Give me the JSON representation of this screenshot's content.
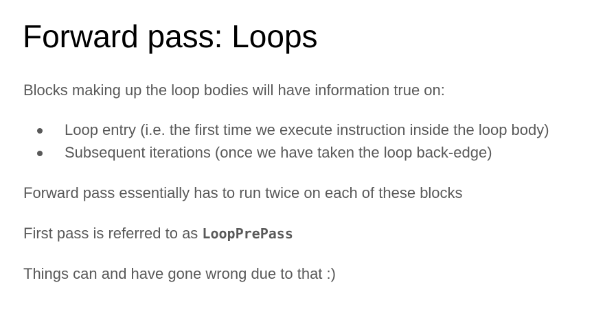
{
  "slide": {
    "title": "Forward pass: Loops",
    "intro": "Blocks making up the loop bodies will have information true on:",
    "bullets": [
      "Loop entry (i.e. the first time we execute instruction inside the loop body)",
      "Subsequent iterations (once we have taken the loop back-edge)"
    ],
    "forward_pass_text": "Forward pass essentially has to run twice on each of these blocks",
    "first_pass_prefix": "First pass is referred to as ",
    "first_pass_code": "LoopPrePass",
    "closing": "Things can and have gone wrong due to that :)"
  },
  "colors": {
    "title": "#000000",
    "body_text": "#595959",
    "background": "#ffffff"
  }
}
